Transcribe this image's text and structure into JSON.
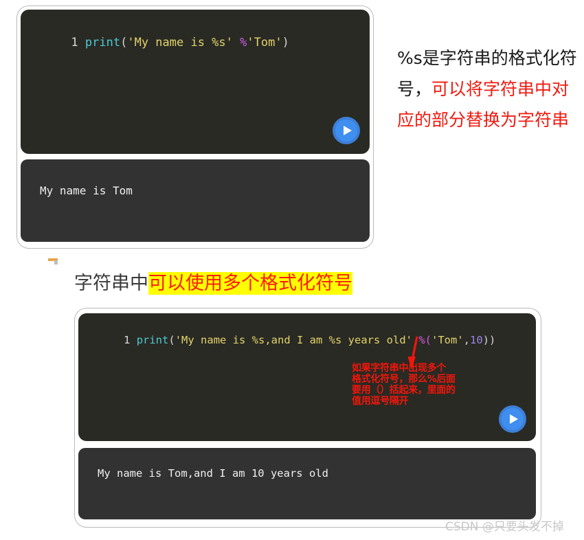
{
  "block1": {
    "code": {
      "line_number": "1",
      "tokens": [
        {
          "t": "print",
          "c": "fn"
        },
        {
          "t": "(",
          "c": "punc"
        },
        {
          "t": "'My name is %s'",
          "c": "str"
        },
        {
          "t": " ",
          "c": "punc"
        },
        {
          "t": "%",
          "c": "op"
        },
        {
          "t": "'Tom'",
          "c": "str"
        },
        {
          "t": ")",
          "c": "punc"
        }
      ],
      "plain": "print('My name is %s' %'Tom')"
    },
    "run_button_label": "run",
    "output": "My name is Tom"
  },
  "side_note": {
    "black_part": "%s是字符串的格式化符号，",
    "red_part": "可以将字符串中对应的部分替换为字符串"
  },
  "heading": {
    "plain_part": "字符串中",
    "highlight_part": "可以使用多个格式化符号"
  },
  "block2": {
    "code": {
      "line_number": "1",
      "tokens": [
        {
          "t": "print",
          "c": "fn"
        },
        {
          "t": "(",
          "c": "punc"
        },
        {
          "t": "'My name is %s,and I am %s years old'",
          "c": "str"
        },
        {
          "t": " ",
          "c": "punc"
        },
        {
          "t": "%(",
          "c": "op"
        },
        {
          "t": "'Tom'",
          "c": "str"
        },
        {
          "t": ",",
          "c": "punc"
        },
        {
          "t": "10",
          "c": "num"
        },
        {
          "t": "))",
          "c": "punc"
        }
      ],
      "plain": "print('My name is %s,and I am %s years old' %('Tom',10))"
    },
    "annotation": "如果字符串中出现多个\n格式化符号，那么%后面\n要用（）括起来，里面的\n值用逗号隔开",
    "run_button_label": "run",
    "output": "My name is Tom,and I am 10 years old"
  },
  "watermark": "CSDN @只要头发不掉",
  "colors": {
    "editor_bg": "#292a24",
    "output_bg": "#323232",
    "accent_red": "#f01a10",
    "highlight_yellow": "#ffff00",
    "run_blue": "#3f8ef0",
    "token_function": "#4ec9d4",
    "token_string": "#e3d36a",
    "token_operator": "#cf5de0",
    "token_number": "#9b84e8"
  }
}
